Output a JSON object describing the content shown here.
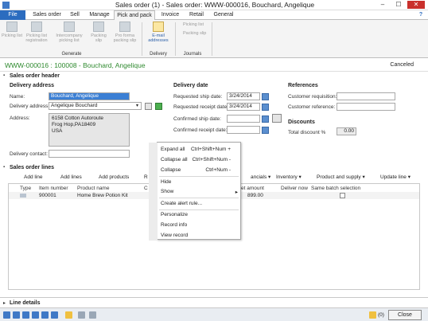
{
  "window": {
    "title": "Sales order (1) - Sales order: WWW-000016, Bouchard, Angelique",
    "minimize": "–",
    "maximize": "☐",
    "close": "✕",
    "help": "?"
  },
  "tabs": [
    "File",
    "Sales order",
    "Sell",
    "Manage",
    "Pick and pack",
    "Invoice",
    "Retail",
    "General"
  ],
  "active_tab": "Pick and pack",
  "ribbon": {
    "generate": {
      "label": "Generate",
      "buttons": [
        "Picking list",
        "Picking list registration",
        "Intercompany picking list",
        "Packing slip",
        "Pro forma packing slip"
      ]
    },
    "delivery": {
      "label": "Delivery",
      "buttons": [
        "E-mail addresses"
      ]
    },
    "journals": {
      "label": "Journals",
      "buttons": [
        "Picking list",
        "Packing slip"
      ]
    }
  },
  "header": {
    "doc_id": "WWW-000016 : 100008 - Bouchard, Angelique",
    "status": "Canceled"
  },
  "section_title": "Sales order header",
  "delivery_address": {
    "title": "Delivery address",
    "name_label": "Name:",
    "name_value": "Bouchard, Angelique",
    "address_label": "Delivery address:",
    "address_value": "Angelique Bouchard",
    "addr_label": "Address:",
    "addr_lines": [
      "6158 Cotton Autoroute",
      "Frog Hop,PA18409",
      "USA"
    ],
    "contact_label": "Delivery contact:"
  },
  "delivery_date": {
    "title": "Delivery date",
    "requested_ship_label": "Requested ship date:",
    "requested_ship_value": "3/24/2014",
    "requested_receipt_label": "Requested receipt date:",
    "requested_receipt_value": "3/24/2014",
    "confirmed_ship_label": "Confirmed ship date:",
    "confirmed_receipt_label": "Confirmed receipt date:"
  },
  "references": {
    "title": "References",
    "customer_requisition_label": "Customer requisition:",
    "customer_reference_label": "Customer reference:"
  },
  "discounts": {
    "title": "Discounts",
    "total_label": "Total discount %",
    "total_value": "0.00"
  },
  "lines_section": "Sales order lines",
  "lines_toolbar": [
    "Add line",
    "Add lines",
    "Add products",
    "R",
    "ancials ▾",
    "Inventory ▾",
    "Product and supply ▾",
    "Update line ▾"
  ],
  "grid": {
    "headers": [
      "Type",
      "Item number",
      "Product name",
      "C",
      "et amount",
      "Deliver now",
      "Same batch selection"
    ],
    "rows": [
      {
        "item": "900001",
        "product": "Home Brew Potion Kit",
        "amount": "899.00"
      }
    ]
  },
  "context_menu": [
    {
      "label": "Expand all",
      "shortcut": "Ctrl+Shift+Num +"
    },
    {
      "label": "Collapse all",
      "shortcut": "Ctrl+Shift+Num -"
    },
    {
      "label": "Collapse",
      "shortcut": "Ctrl+Num -"
    },
    {
      "label": "Hide",
      "shortcut": ""
    },
    {
      "label": "Show",
      "shortcut": "▸"
    },
    {
      "label": "Create alert rule...",
      "shortcut": ""
    },
    {
      "label": "Personalize",
      "shortcut": ""
    },
    {
      "label": "Record info",
      "shortcut": ""
    },
    {
      "label": "View record",
      "shortcut": ""
    }
  ],
  "line_details": "Line details",
  "bottom": {
    "close": "Close",
    "alerts": "(0)"
  },
  "colors": {
    "accent": "#2b6cbf",
    "id_green": "#2f8a2f",
    "close_red": "#c9302c"
  }
}
